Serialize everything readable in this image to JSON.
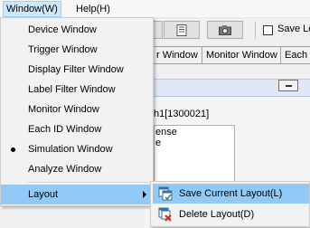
{
  "menubar": {
    "window_label": "Window(W)",
    "help_label": "Help(H)"
  },
  "toolbar": {
    "save_layout_partial": "Save Lo"
  },
  "tabs": [
    {
      "label": "r Window"
    },
    {
      "label": "Monitor Window"
    },
    {
      "label": "Each I"
    }
  ],
  "panel": {
    "channel_text": "h1[1300021]",
    "list_line1": "ense",
    "list_line2": "e"
  },
  "window_menu": {
    "items": [
      {
        "label": "Device Window"
      },
      {
        "label": "Trigger Window"
      },
      {
        "label": "Display Filter Window"
      },
      {
        "label": "Label Filter Window"
      },
      {
        "label": "Monitor Window"
      },
      {
        "label": "Each ID Window"
      },
      {
        "label": "Simulation Window"
      },
      {
        "label": "Analyze Window"
      }
    ],
    "layout_label": "Layout",
    "checked_item": "Simulation Window"
  },
  "layout_submenu": {
    "save_label": "Save Current Layout(L)",
    "delete_label": "Delete Layout(D)"
  },
  "colors": {
    "highlight": "#91c9f7",
    "menubar_active": "#cce8ff"
  }
}
